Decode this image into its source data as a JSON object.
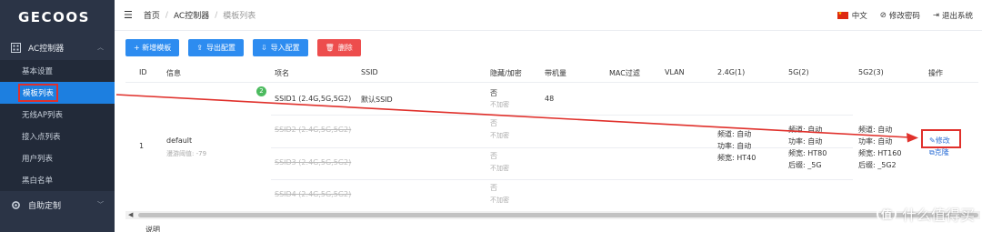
{
  "brand": "GECOOS",
  "sidebar": {
    "group1": "AC控制器",
    "items": [
      {
        "label": "基本设置"
      },
      {
        "label": "模板列表"
      },
      {
        "label": "无线AP列表"
      },
      {
        "label": "接入点列表"
      },
      {
        "label": "用户列表"
      },
      {
        "label": "黑白名单"
      }
    ],
    "group2": "自助定制"
  },
  "header": {
    "breadcrumb": [
      "首页",
      "AC控制器",
      "模板列表"
    ],
    "lang": "中文",
    "change_pwd": "修改密码",
    "logout": "退出系统"
  },
  "toolbar": {
    "add": "+ 新增模板",
    "export": "导出配置",
    "import": "导入配置",
    "delete": "删除"
  },
  "table": {
    "headers": [
      "ID",
      "信息",
      "项名",
      "SSID",
      "隐藏/加密",
      "带机量",
      "MAC过滤",
      "VLAN",
      "2.4G(1)",
      "5G(2)",
      "5G2(3)",
      "操作"
    ],
    "id": "1",
    "name": "default",
    "roaming": "漫游阈值: -79",
    "badge": "2",
    "ssids": [
      {
        "item": "SSID1 (2.4G,5G,5G2)",
        "ssid": "默认SSID",
        "hidden": "否",
        "enc": "不加密",
        "load": "48"
      },
      {
        "item": "SSID2 (2.4G,5G,5G2)",
        "ssid": "",
        "hidden": "否",
        "enc": "不加密",
        "load": ""
      },
      {
        "item": "SSID3 (2.4G,5G,5G2)",
        "ssid": "",
        "hidden": "否",
        "enc": "不加密",
        "load": ""
      },
      {
        "item": "SSID4 (2.4G,5G,5G2)",
        "ssid": "",
        "hidden": "否",
        "enc": "不加密",
        "load": ""
      }
    ],
    "radio24": {
      "channel": "频道: 自动",
      "power": "功率: 自动",
      "width": "频宽: HT40"
    },
    "radio5": {
      "channel": "频道: 自动",
      "power": "功率: 自动",
      "width": "频宽: HT80",
      "suffix": "后缀: _5G"
    },
    "radio52": {
      "channel": "频道: 自动",
      "power": "功率: 自动",
      "width": "频宽: HT160",
      "suffix": "后缀: _5G2"
    },
    "op_edit": "修改",
    "op_clone": "克隆"
  },
  "footer": "说明",
  "watermark": "什么值得买",
  "watermark_icon": "值",
  "colors": {
    "sidebar": "#2b3446",
    "active": "#1d7fe0",
    "primary": "#2d8cf0",
    "danger": "#ed4d4d",
    "annotation": "#e0302b"
  }
}
